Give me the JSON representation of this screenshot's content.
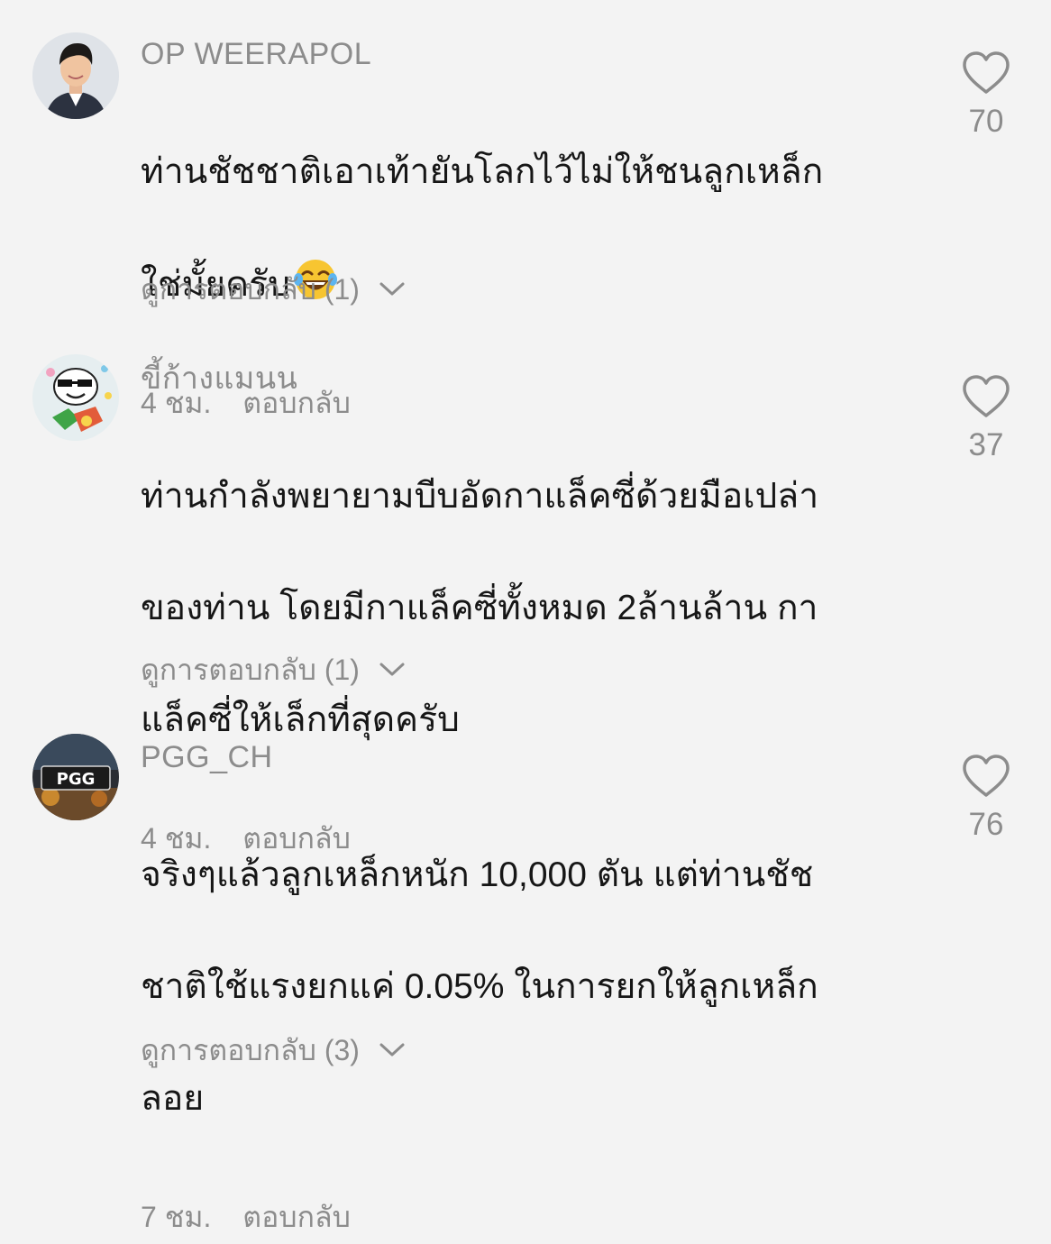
{
  "comments": [
    {
      "username": "OP WEERAPOL",
      "lines": [
        "ท่านชัชชาติเอาเท้ายันโลกไว้ไม่ให้ชนลูกเหล็ก",
        "ใช่มั้ยครับ"
      ],
      "emoji": "😂",
      "time": "4 ชม.",
      "reply_label": "ตอบกลับ",
      "view_replies": "ดูการตอบกลับ (1)",
      "likes": "70"
    },
    {
      "username": "ขี้ก้างแมนน",
      "lines": [
        "ท่านกำลังพยายามบีบอัดกาแล็คซี่ด้วยมือเปล่า",
        "ของท่าน โดยมีกาแล็คซี่ทั้งหมด 2ล้านล้าน กา",
        "แล็คซี่ให้เล็กที่สุดครับ"
      ],
      "time": "4 ชม.",
      "reply_label": "ตอบกลับ",
      "view_replies": "ดูการตอบกลับ (1)",
      "likes": "37"
    },
    {
      "username": "PGG_CH",
      "lines": [
        "จริงๆแล้วลูกเหล็กหนัก 10,000 ตัน แต่ท่านชัช",
        "ชาติใช้แรงยกแค่ 0.05% ในการยกให้ลูกเหล็ก",
        "ลอย"
      ],
      "time": "7 ชม.",
      "reply_label": "ตอบกลับ",
      "view_replies": "ดูการตอบกลับ (3)",
      "likes": "76",
      "avatar_text": "PGG"
    }
  ],
  "colors": {
    "background": "#f3f3f3",
    "text": "#161616",
    "muted": "#8c8c8c"
  },
  "icons": {
    "like": "heart-outline-icon",
    "expand": "chevron-down-icon"
  }
}
